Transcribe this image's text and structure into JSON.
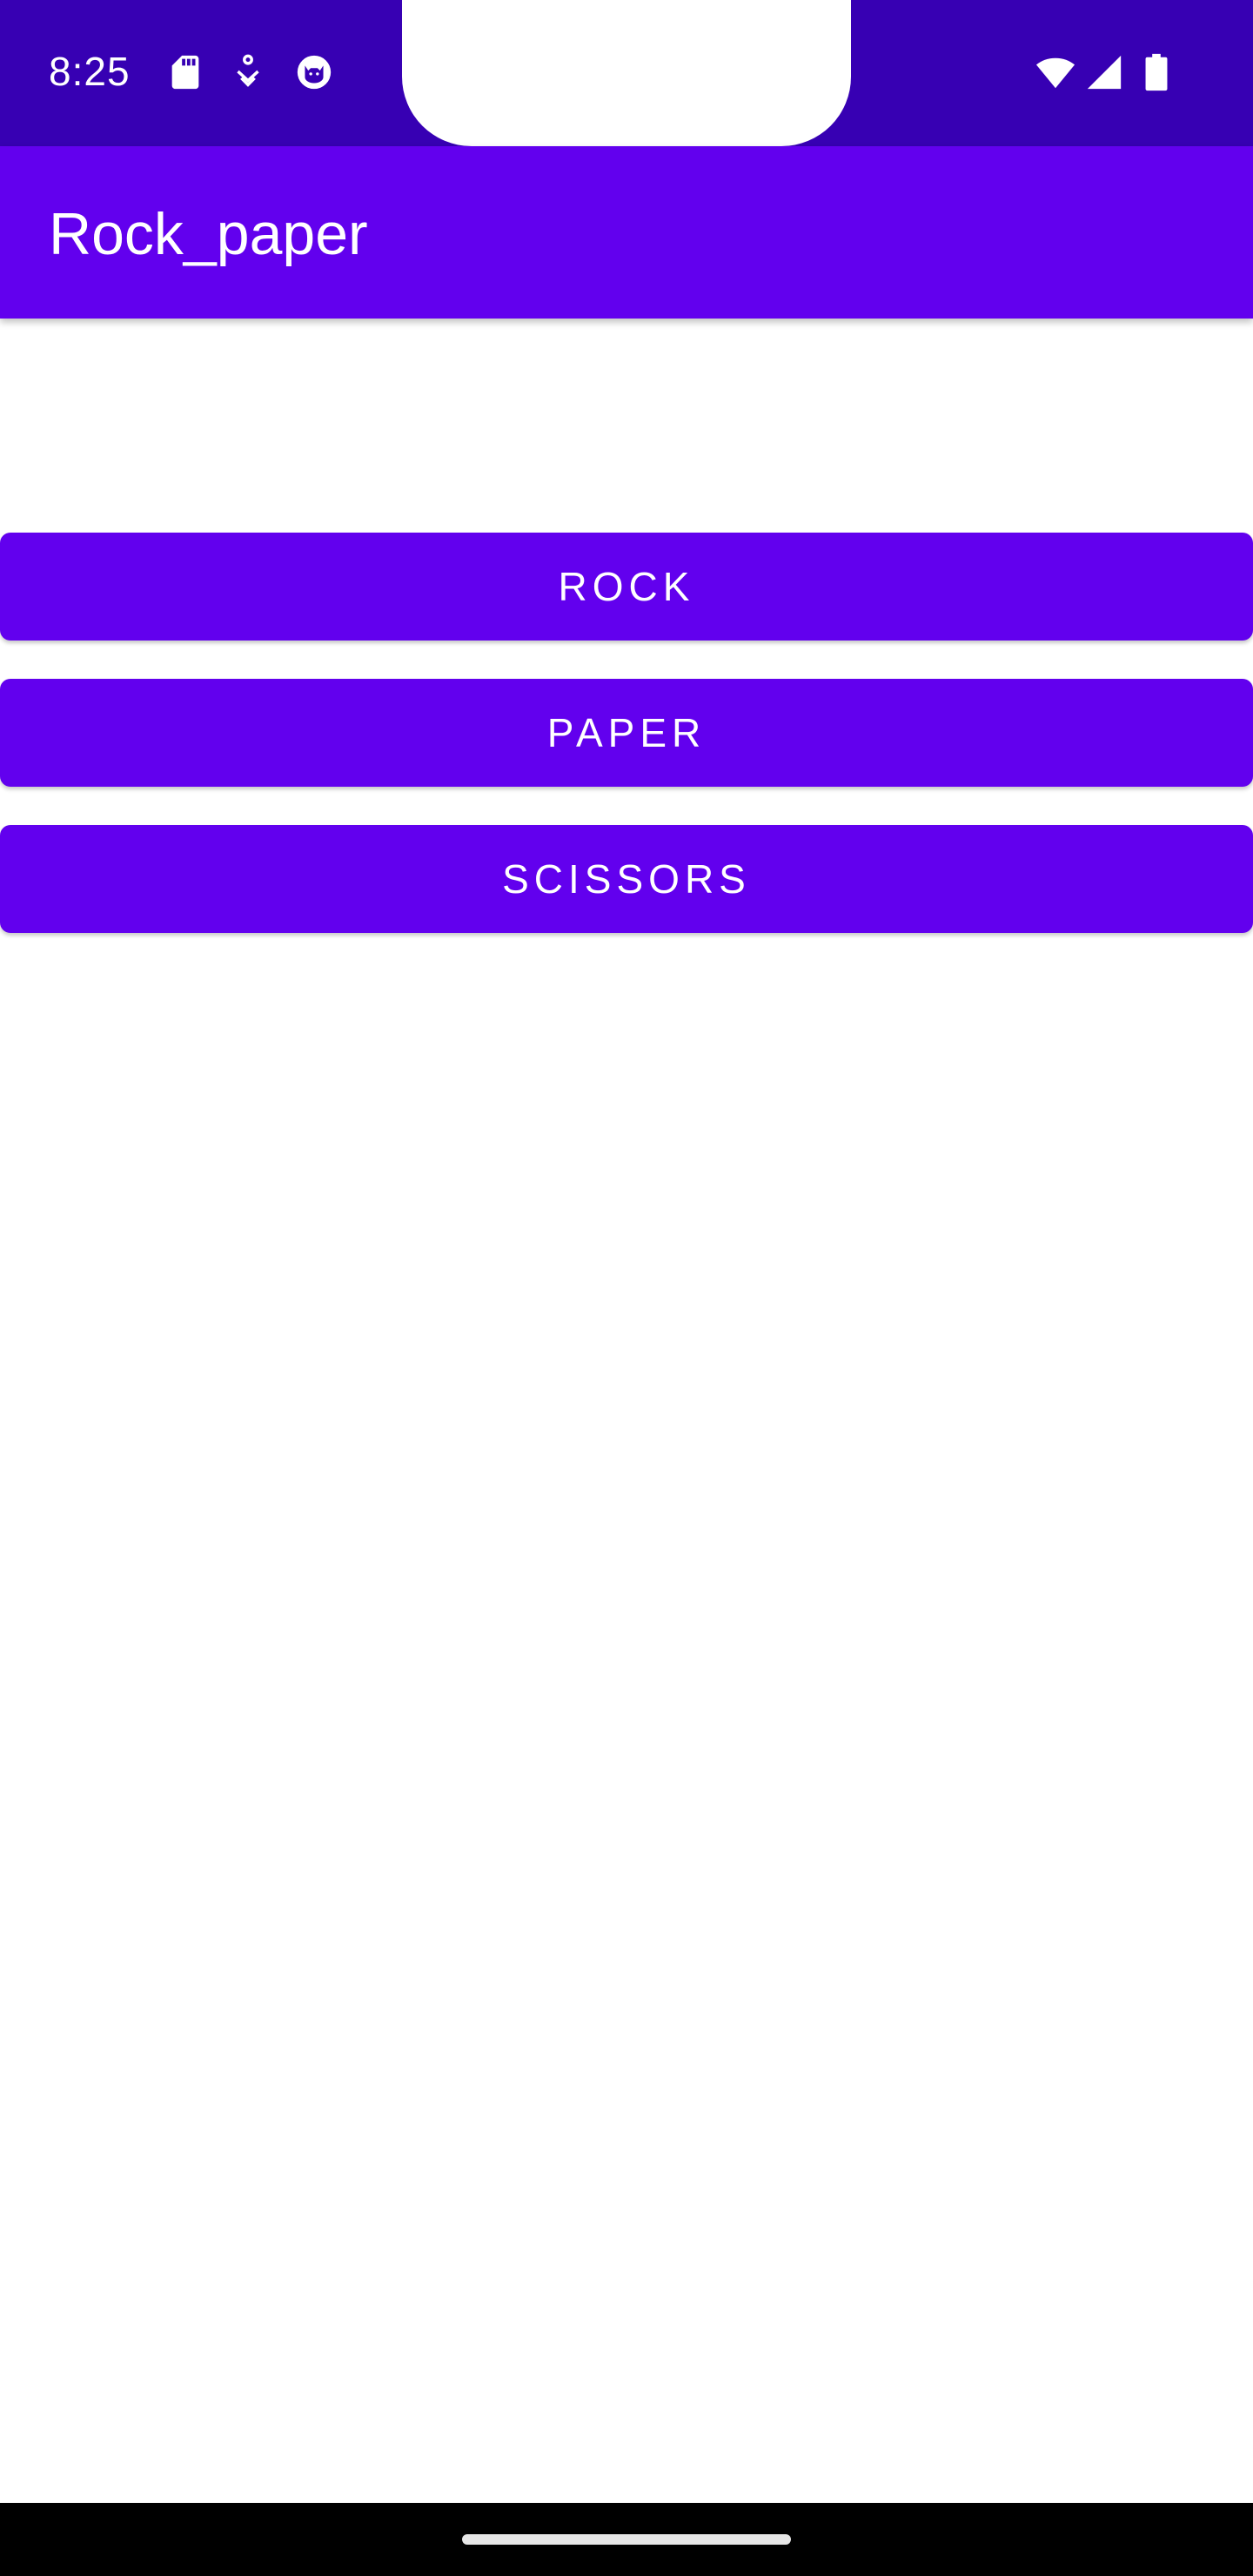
{
  "status_bar": {
    "time": "8:25",
    "background_color": "#3700b3",
    "left_icons": [
      "sd-card-icon",
      "accessibility-icon",
      "cat-face-icon"
    ],
    "right_icons": [
      "wifi-icon",
      "signal-icon",
      "battery-icon"
    ]
  },
  "app_bar": {
    "title": "Rock_paper",
    "background_color": "#6200ee"
  },
  "buttons": {
    "rock": "ROCK",
    "paper": "PAPER",
    "scissors": "SCISSORS",
    "background_color": "#6200ee",
    "text_color": "#ffffff"
  },
  "nav_bar": {
    "icon": "home-handle"
  }
}
